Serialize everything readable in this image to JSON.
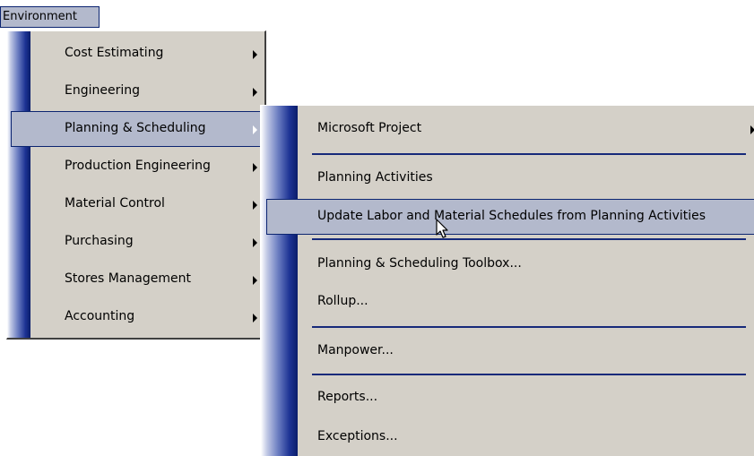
{
  "menubar": {
    "environment_label": "Environment"
  },
  "environment_menu": {
    "items": [
      {
        "label": "Cost Estimating",
        "has_submenu": true
      },
      {
        "label": "Engineering",
        "has_submenu": true
      },
      {
        "label": "Planning & Scheduling",
        "has_submenu": true,
        "selected": true
      },
      {
        "label": "Production Engineering",
        "has_submenu": true
      },
      {
        "label": "Material Control",
        "has_submenu": true
      },
      {
        "label": "Purchasing",
        "has_submenu": true
      },
      {
        "label": "Stores Management",
        "has_submenu": true
      },
      {
        "label": "Accounting",
        "has_submenu": true
      }
    ]
  },
  "planning_submenu": {
    "items": [
      {
        "label": "Microsoft Project",
        "has_submenu": true
      },
      {
        "label": "Planning Activities"
      },
      {
        "label": "Update Labor and Material Schedules from Planning Activities",
        "selected": true
      },
      {
        "label": "Planning & Scheduling Toolbox..."
      },
      {
        "label": "Rollup..."
      },
      {
        "label": "Manpower..."
      },
      {
        "label": "Reports..."
      },
      {
        "label": "Exceptions..."
      }
    ]
  },
  "colors": {
    "menu_background": "#d4d0c8",
    "selection_background": "#b3b9cc",
    "selection_border": "#0b2470",
    "gutter_dark": "#0a1d6a",
    "separator": "#16297a"
  },
  "cursor_icon": "arrow-pointer-icon"
}
